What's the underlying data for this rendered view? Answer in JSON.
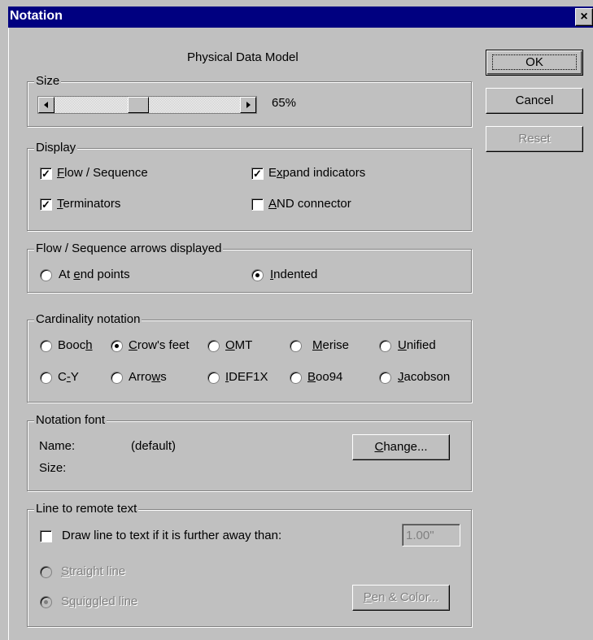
{
  "window": {
    "title": "Notation",
    "close_glyph": "×"
  },
  "model_title": "Physical Data Model",
  "buttons": {
    "ok": "OK",
    "cancel": "Cancel",
    "reset": "Reset"
  },
  "size": {
    "label": "Size",
    "value": "65%",
    "slider_fraction": 0.44
  },
  "display": {
    "label": "Display",
    "flow_sequence": {
      "pre": "",
      "key": "F",
      "post": "low / Sequence",
      "checked": true
    },
    "terminators": {
      "pre": "",
      "key": "T",
      "post": "erminators",
      "checked": true
    },
    "expand_indicators": {
      "pre": "E",
      "key": "x",
      "post": "pand indicators",
      "checked": true
    },
    "and_connector": {
      "pre": "",
      "key": "A",
      "post": "ND connector",
      "checked": false
    }
  },
  "arrows": {
    "label": "Flow / Sequence arrows displayed",
    "end_points": {
      "pre": "At ",
      "key": "e",
      "post": "nd points"
    },
    "indented": {
      "pre": "",
      "key": "I",
      "post": "ndented"
    },
    "selected": "indented"
  },
  "cardinality": {
    "label": "Cardinality notation",
    "booch": {
      "pre": "Booc",
      "key": "h",
      "post": ""
    },
    "crows": {
      "pre": "",
      "key": "C",
      "post": "row's feet"
    },
    "omt": {
      "pre": "",
      "key": "O",
      "post": "MT"
    },
    "merise": {
      "pre": "",
      "key": "M",
      "post": "erise"
    },
    "unified": {
      "pre": "",
      "key": "U",
      "post": "nified"
    },
    "cy": {
      "pre": "C",
      "key": "-",
      "post": "Y"
    },
    "arrows": {
      "pre": "Arro",
      "key": "w",
      "post": "s"
    },
    "idef1x": {
      "pre": "",
      "key": "I",
      "post": "DEF1X"
    },
    "boo94": {
      "pre": "",
      "key": "B",
      "post": "oo94"
    },
    "jacobson": {
      "pre": "",
      "key": "J",
      "post": "acobson"
    },
    "selected": "crows"
  },
  "font": {
    "label": "Notation font",
    "name_label": "Name:",
    "name_value": "(default)",
    "size_label": "Size:",
    "change": {
      "pre": "",
      "key": "C",
      "post": "hange..."
    }
  },
  "remote": {
    "label": "Line to remote text",
    "draw_line": {
      "pre": "Draw line to text if it is further away than:",
      "checked": false
    },
    "distance": "1.00\"",
    "straight": {
      "pre": "",
      "key": "S",
      "post": "traight line"
    },
    "squiggled": {
      "pre": "S",
      "key": "q",
      "post": "uiggled line"
    },
    "pen_color": {
      "pre": "",
      "key": "P",
      "post": "en & Color..."
    },
    "selected": "squiggled"
  },
  "colors": {
    "titlebar": "#000080",
    "face": "#c0c0c0",
    "disabled": "#808080"
  }
}
